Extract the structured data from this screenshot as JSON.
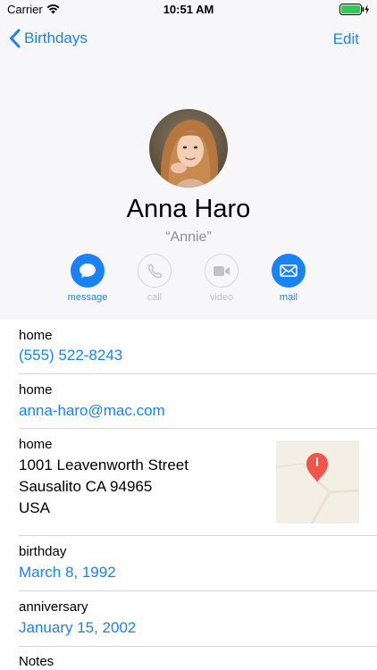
{
  "status_bar": {
    "carrier": "Carrier",
    "time": "10:51 AM",
    "wifi_icon": "wifi-icon",
    "battery_icon": "battery-charging-icon"
  },
  "nav": {
    "back_label": "Birthdays",
    "edit_label": "Edit",
    "accent_color": "#1a82f7"
  },
  "contact": {
    "name": "Anna Haro",
    "nickname": "“Annie”"
  },
  "actions": [
    {
      "label": "message",
      "icon": "message-icon",
      "enabled": true
    },
    {
      "label": "call",
      "icon": "phone-icon",
      "enabled": false
    },
    {
      "label": "video",
      "icon": "video-camera-icon",
      "enabled": false
    },
    {
      "label": "mail",
      "icon": "mail-icon",
      "enabled": true
    }
  ],
  "fields": {
    "phone": {
      "label": "home",
      "value": "(555) 522-8243"
    },
    "email": {
      "label": "home",
      "value": "anna-haro@mac.com"
    },
    "address": {
      "label": "home",
      "line1": "1001  Leavenworth Street",
      "line2": "Sausalito CA 94965",
      "line3": "USA"
    },
    "birthday": {
      "label": "birthday",
      "value": "March 8, 1992"
    },
    "anniversary": {
      "label": "anniversary",
      "value": "January 15, 2002"
    },
    "notes": {
      "label": "Notes"
    }
  }
}
